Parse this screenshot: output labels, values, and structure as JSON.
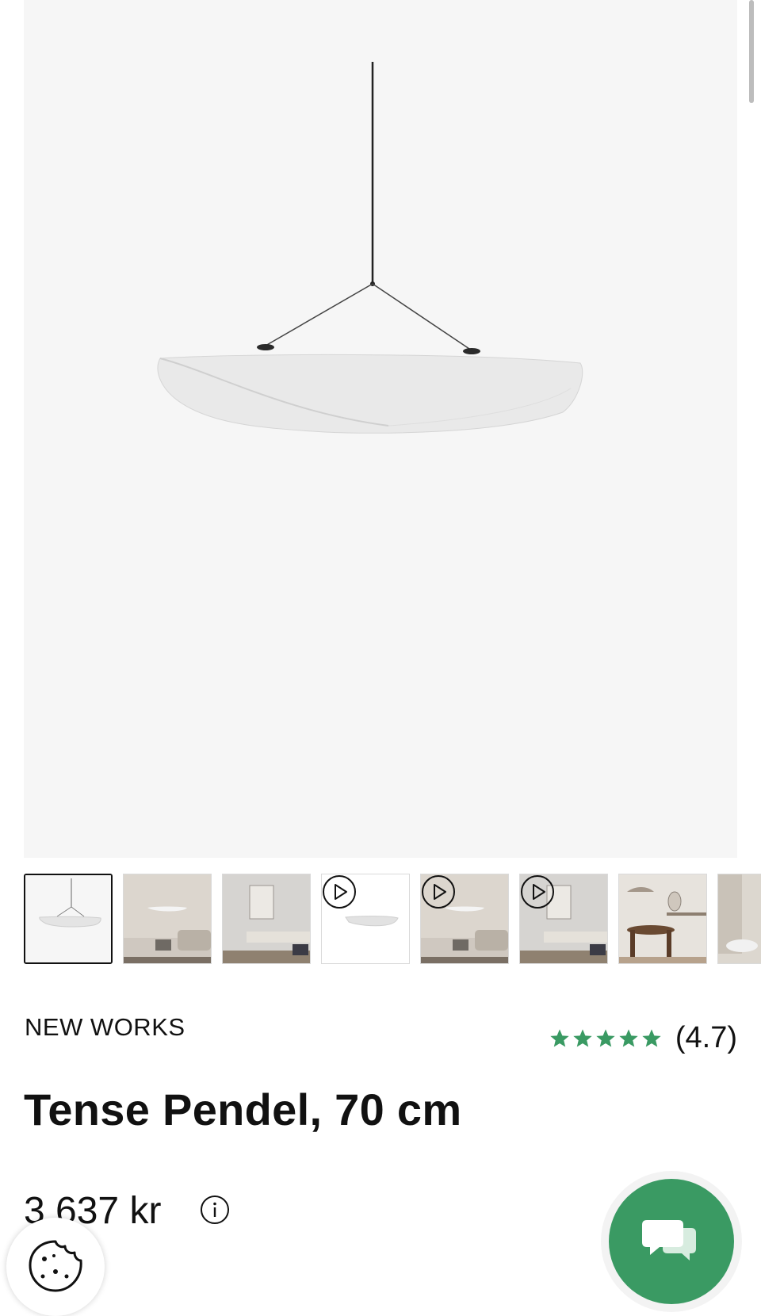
{
  "product": {
    "brand": "NEW WORKS",
    "title": "Tense Pendel, 70 cm",
    "price": "3.637 kr",
    "rating_value": "(4.7)",
    "rating_stars": 5
  },
  "gallery": {
    "thumbnails": [
      {
        "kind": "image",
        "selected": true
      },
      {
        "kind": "image",
        "selected": false
      },
      {
        "kind": "image",
        "selected": false
      },
      {
        "kind": "video",
        "selected": false
      },
      {
        "kind": "video",
        "selected": false
      },
      {
        "kind": "video",
        "selected": false
      },
      {
        "kind": "image",
        "selected": false
      },
      {
        "kind": "image",
        "selected": false
      }
    ]
  },
  "icons": {
    "info": "info-icon",
    "chat": "chat-bubbles-icon",
    "cookie": "cookie-icon",
    "star": "star-icon",
    "play": "play-icon"
  },
  "colors": {
    "star": "#3a9a63",
    "chat_button": "#3a9a63"
  }
}
